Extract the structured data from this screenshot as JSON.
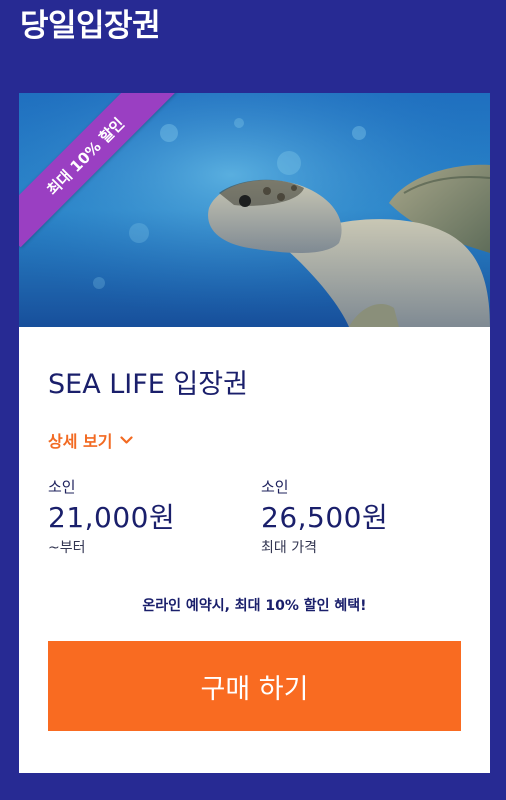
{
  "page": {
    "title": "당일입장권"
  },
  "card": {
    "ribbon_text": "최대 10% 할인",
    "hero_image": "sea-turtle-photo",
    "title": "SEA LIFE 입장권",
    "details_link": {
      "label": "상세 보기",
      "icon": "chevron-down-icon"
    },
    "prices": [
      {
        "category": "소인",
        "amount": "21,000원",
        "note": "~부터"
      },
      {
        "category": "소인",
        "amount": "26,500원",
        "note": "최대 가격"
      }
    ],
    "promo": "온라인 예약시, 최대 10% 할인 혜택!",
    "buy_label": "구매 하기"
  },
  "colors": {
    "background": "#272a93",
    "accent_orange": "#f96b21",
    "ribbon_purple": "#9a3fc2",
    "text_navy": "#1a1f6b"
  }
}
